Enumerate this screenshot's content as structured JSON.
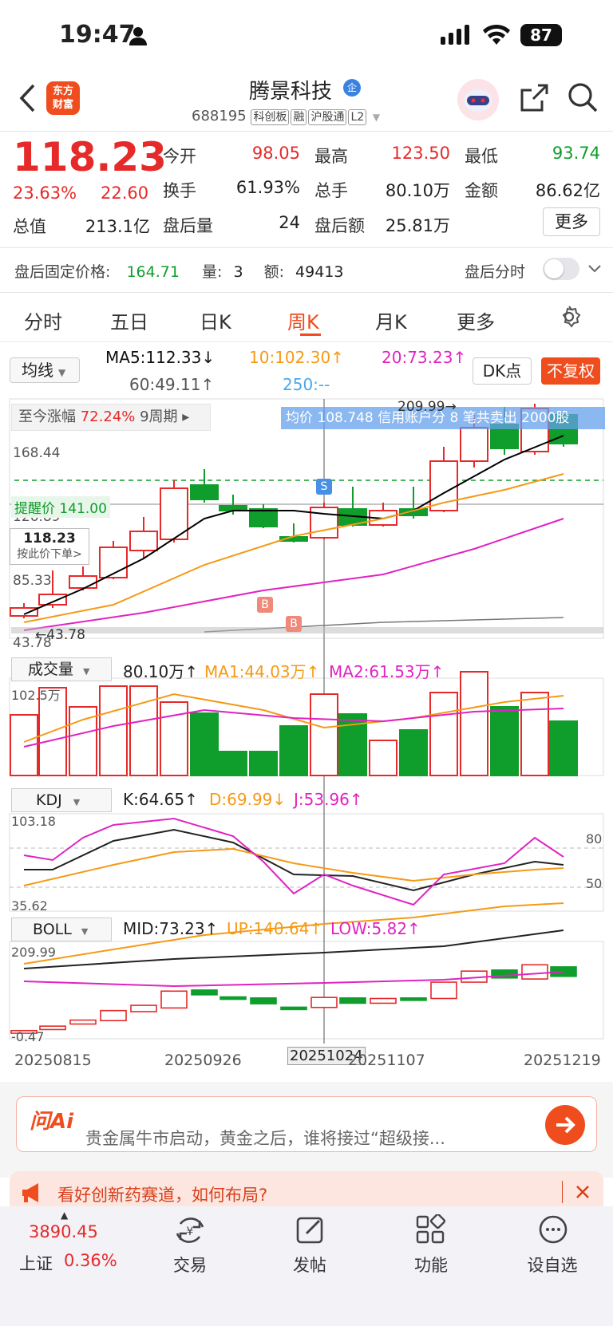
{
  "status": {
    "time": "19:47",
    "battery": "87"
  },
  "header": {
    "title": "腾景科技",
    "code": "688195",
    "tags": [
      "科创板",
      "融",
      "沪股通",
      "L2"
    ],
    "logo_text_1": "东方",
    "logo_text_2": "财富",
    "title_badge": "企"
  },
  "quote": {
    "price": "118.23",
    "change_pct": "23.63%",
    "change": "22.60",
    "open_label": "今开",
    "open": "98.05",
    "high_label": "最高",
    "high": "123.50",
    "low_label": "最低",
    "low": "93.74",
    "turnover_label": "换手",
    "turnover": "61.93%",
    "volume_label": "总手",
    "volume": "80.10万",
    "amount_label": "金额",
    "amount": "86.62亿",
    "mcap_label": "总值",
    "mcap": "213.1亿",
    "after_vol_label": "盘后量",
    "after_vol": "24",
    "after_amt_label": "盘后额",
    "after_amt": "25.81万",
    "more_label": "更多"
  },
  "after_hours": {
    "price_label": "盘后固定价格:",
    "price": "164.71",
    "qty_label": "量:",
    "qty": "3",
    "amt_label": "额:",
    "amt": "49413",
    "toggle_label": "盘后分时"
  },
  "tabs": [
    "分时",
    "五日",
    "日K",
    "周K",
    "月K",
    "更多"
  ],
  "active_tab": "周K",
  "ma": {
    "selector": "均线",
    "ma5": "MA5:112.33↓",
    "ma10": "10:102.30↑",
    "ma20": "20:73.23↑",
    "ma60": "60:49.11↑",
    "ma250": "250:--",
    "dk": "DK点",
    "adj": "不复权"
  },
  "kchart": {
    "range_label": "至今涨幅",
    "range_pct": "72.24%",
    "range_period": "9周期",
    "banner": "均价 108.748 信用账户分 8 笔共卖出 2000股",
    "y_labels": [
      "168.44",
      "126.89",
      "85.33",
      "43.78"
    ],
    "high_mark": "209.99→",
    "low_mark": "←43.78",
    "alert_label": "提醒价 141.00",
    "cross_price": "118.23",
    "cross_hint": "按此价下单>",
    "markers": {
      "s": "S",
      "b": "B"
    }
  },
  "volume": {
    "selector": "成交量",
    "value": "80.10万↑",
    "ma1": "MA1:44.03万↑",
    "ma2": "MA2:61.53万↑",
    "top": "102.5万"
  },
  "kdj": {
    "selector": "KDJ",
    "k": "K:64.65↑",
    "d": "D:69.99↓",
    "j": "J:53.96↑",
    "top": "103.18",
    "bottom": "35.62",
    "l80": "80",
    "l50": "50"
  },
  "boll": {
    "selector": "BOLL",
    "mid": "MID:73.23↑",
    "up": "UP:140.64↑",
    "low": "LOW:5.82↑",
    "top": "209.99",
    "bottom": "-0.47"
  },
  "dates": [
    "20250815",
    "20250926",
    "20251024",
    "20251107",
    "20251219"
  ],
  "ai": {
    "label": "问Ai",
    "text": "贵金属牛市启动，黄金之后，谁将接过“超级接..."
  },
  "news": {
    "text": "看好创新药赛道，如何布局?"
  },
  "bottom": {
    "index_value": "3890.45",
    "index_name": "上证",
    "index_pct": "0.36%",
    "trade": "交易",
    "post": "发帖",
    "func": "功能",
    "watch": "设自选"
  },
  "colors": {
    "up": "#e62a2a",
    "down": "#0f9d2c",
    "accent": "#f04d1f",
    "ma5": "#000000",
    "ma10": "#f59a16",
    "ma20": "#e023c2",
    "ma250": "#4aa8ec"
  }
}
